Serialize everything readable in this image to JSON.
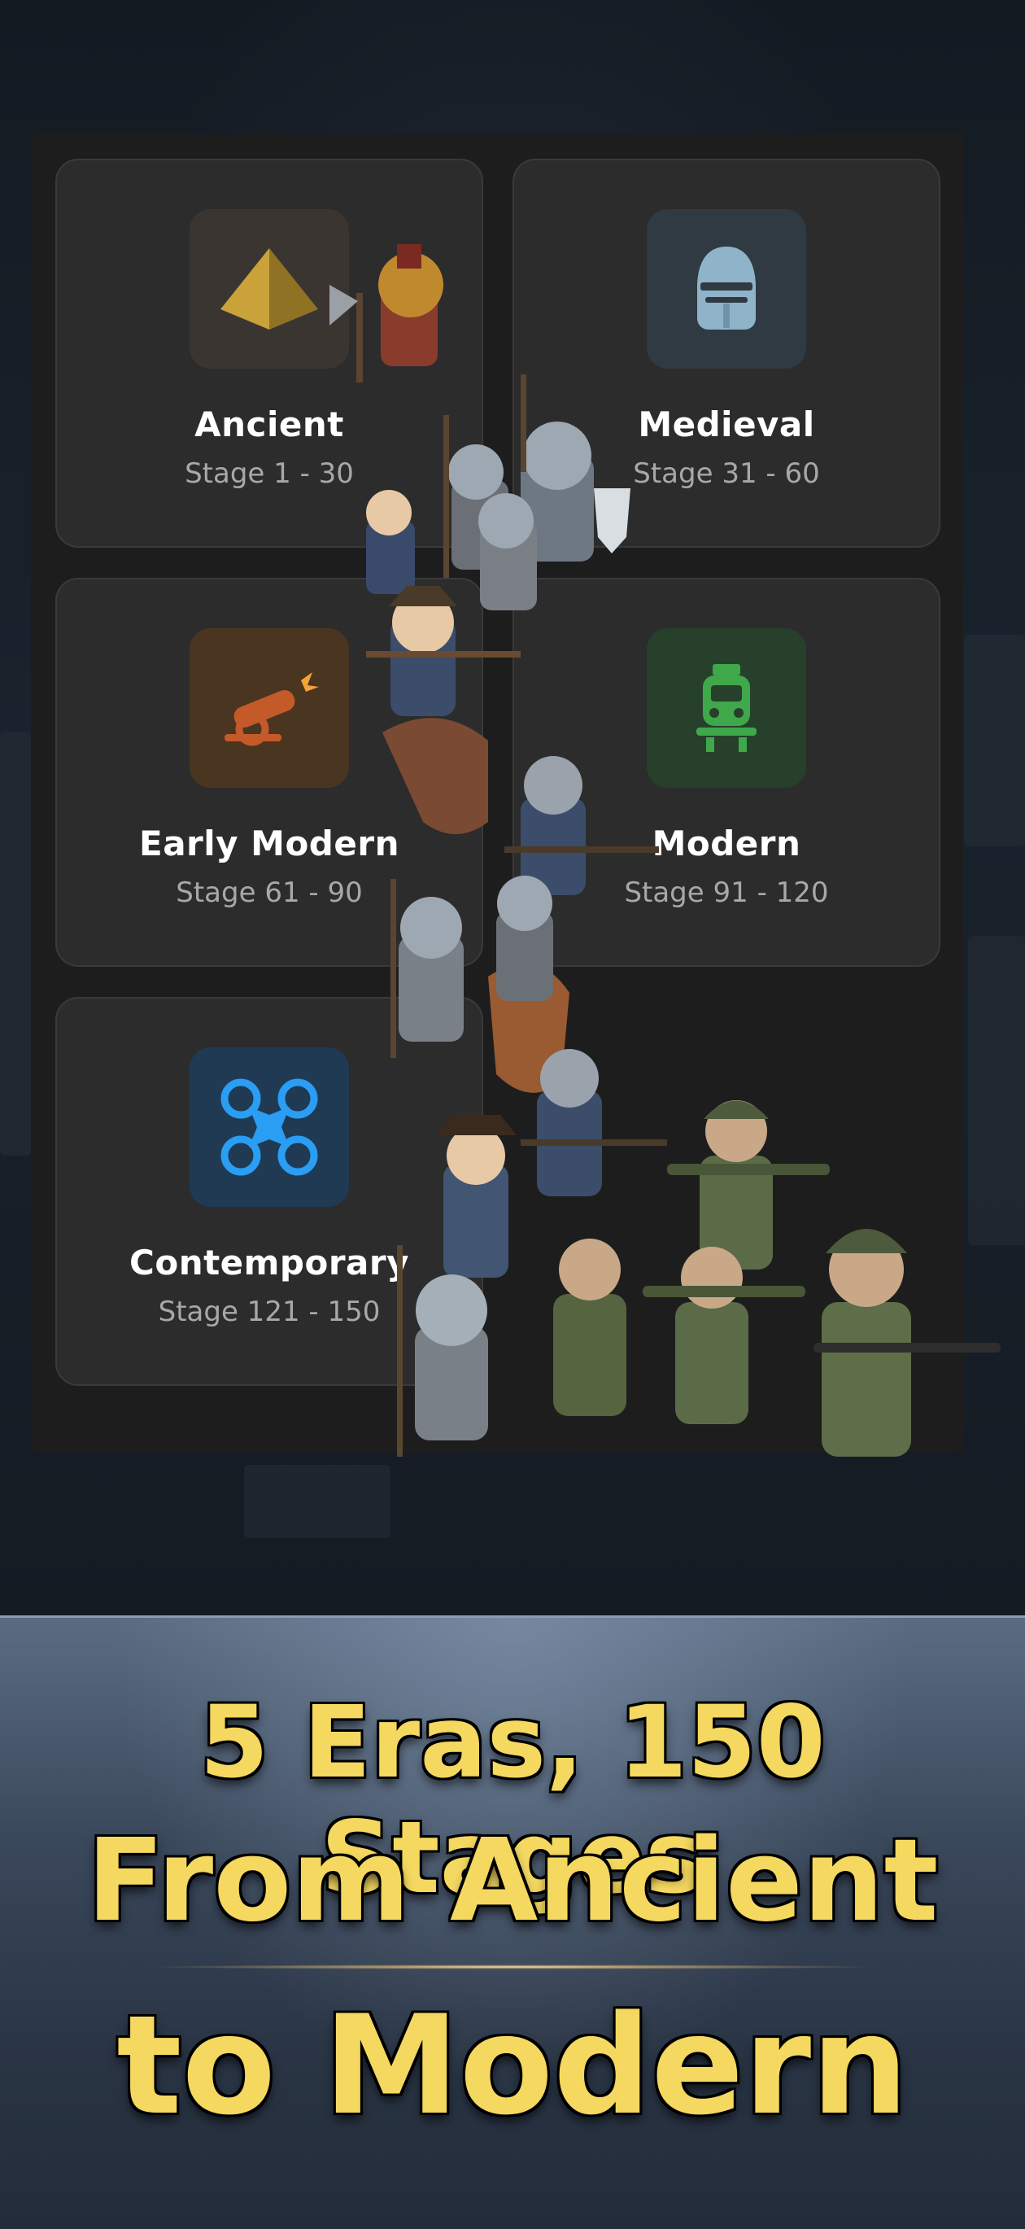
{
  "eras": [
    {
      "name": "Ancient",
      "stages": "Stage 1 - 30",
      "icon": "pyramid-icon",
      "icon_bg": "#3b3532"
    },
    {
      "name": "Medieval",
      "stages": "Stage 31 - 60",
      "icon": "knight-helmet-icon",
      "icon_bg": "#2f3a42"
    },
    {
      "name": "Early Modern",
      "stages": "Stage 61 - 90",
      "icon": "cannon-icon",
      "icon_bg": "#4a3520"
    },
    {
      "name": "Modern",
      "stages": "Stage 91 - 120",
      "icon": "locomotive-icon",
      "icon_bg": "#26402b"
    },
    {
      "name": "Contemporary",
      "stages": "Stage 121 - 150",
      "icon": "drone-icon",
      "icon_bg": "#1f3a52"
    }
  ],
  "promo": {
    "line1": "5 Eras, 150 Stages",
    "line2": "From Ancient",
    "line3": "to Modern"
  },
  "colors": {
    "card_bg": "#2c2c2c",
    "panel_bg": "#1d1d1d",
    "promo_text": "#f4d860",
    "accent_blue": "#2a9df4"
  }
}
